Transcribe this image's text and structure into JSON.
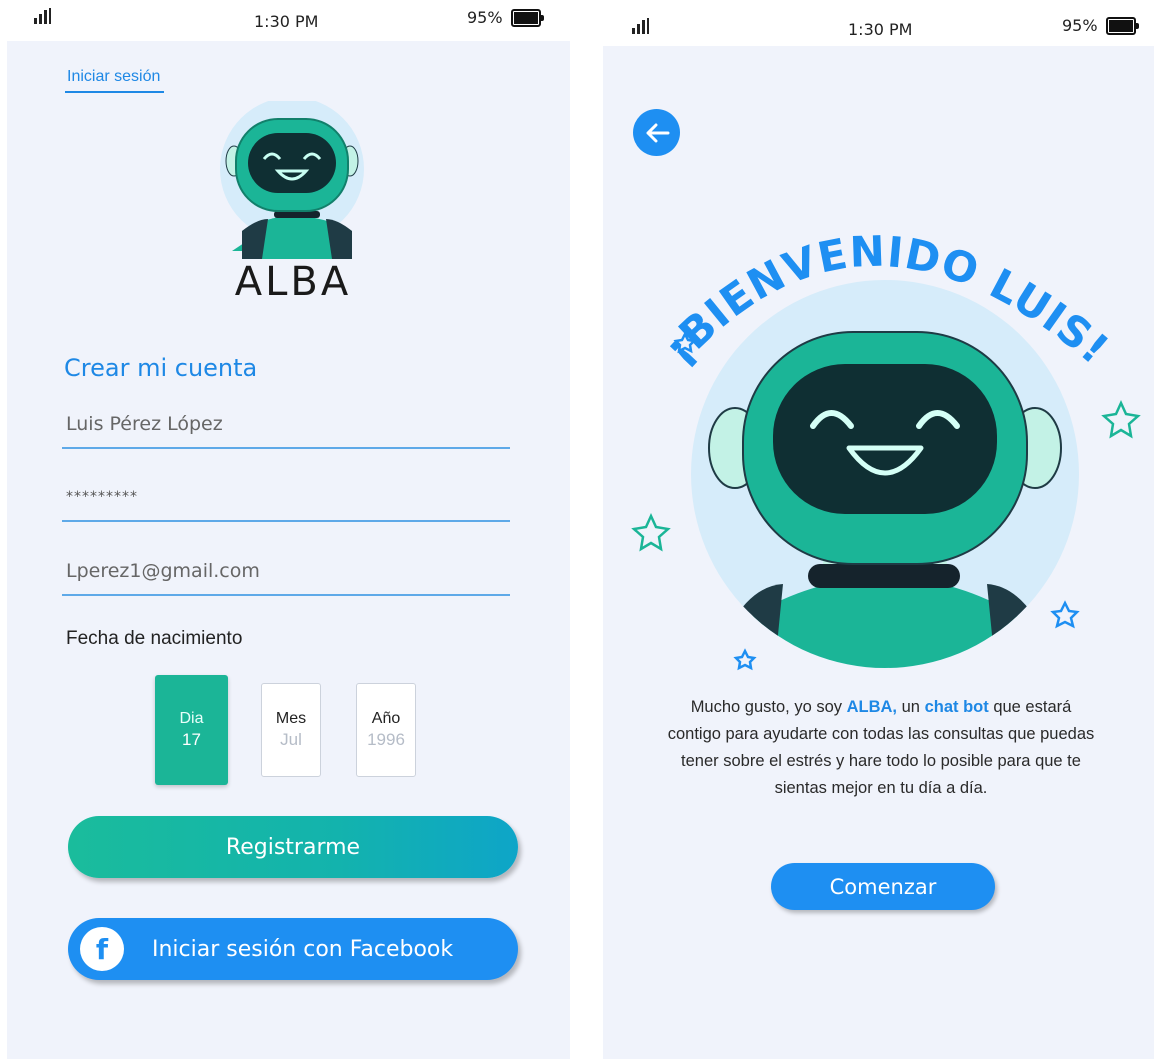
{
  "status_left": {
    "time": "1:30 PM",
    "battery": "95%"
  },
  "status_right": {
    "time": "1:30 PM",
    "battery": "95%"
  },
  "register": {
    "login_link": "Iniciar sesión",
    "brand": "ALBA",
    "section_title": "Crear mi cuenta",
    "name_value": "Luis Pérez López",
    "password_value": "*********",
    "email_value": "Lperez1@gmail.com",
    "dob_label": "Fecha de nacimiento",
    "day": {
      "label": "Dia",
      "value": "17"
    },
    "month": {
      "label": "Mes",
      "value": "Jul"
    },
    "year": {
      "label": "Año",
      "value": "1996"
    },
    "register_button": "Registrarme",
    "facebook_button": "Iniciar sesión con Facebook",
    "facebook_icon": "f"
  },
  "welcome": {
    "heading": "¡BIENVENIDO LUIS!",
    "msg_1": "Mucho gusto, yo soy ",
    "msg_bold_1": "ALBA,",
    "msg_2": " un ",
    "msg_bold_2": "chat bot",
    "msg_3": " que estará contigo para ayudarte con todas las consultas que puedas tener sobre el estrés y hare todo lo posible para que te sientas mejor en tu día a día.",
    "start_button": "Comenzar"
  },
  "colors": {
    "accent_blue": "#1e8ff2",
    "teal": "#1bb597",
    "background": "#f0f3fb"
  },
  "icons": [
    "signal-icon",
    "battery-icon",
    "robot-logo",
    "facebook-icon",
    "back-arrow-icon",
    "star-icon"
  ]
}
